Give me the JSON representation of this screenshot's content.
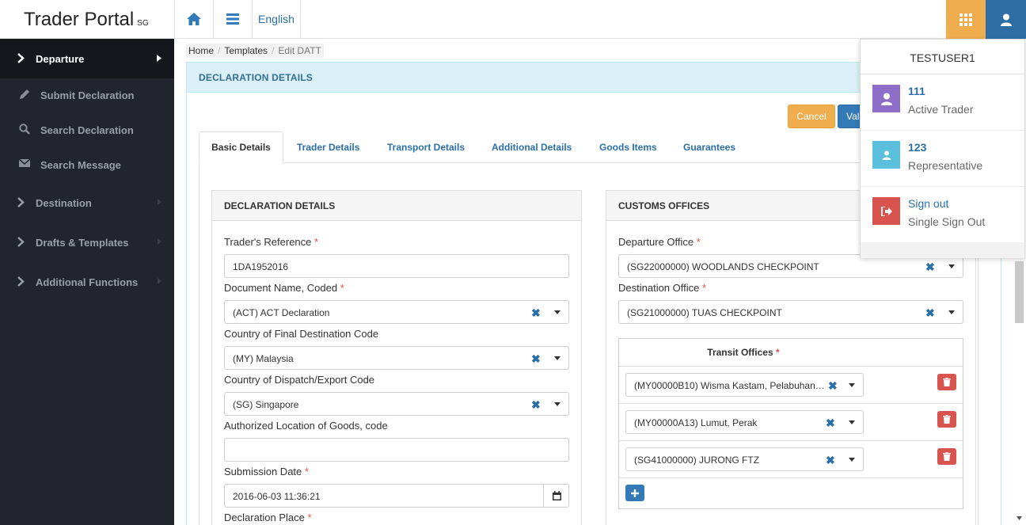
{
  "brand": {
    "title": "Trader Portal",
    "sub": "SG"
  },
  "topbar": {
    "language": "English"
  },
  "sidebar": {
    "departure": "Departure",
    "submit": "Submit Declaration",
    "search": "Search Declaration",
    "search_msg": "Search Message",
    "destination": "Destination",
    "drafts": "Drafts & Templates",
    "additional": "Additional Functions"
  },
  "breadcrumb": {
    "home": "Home",
    "templates": "Templates",
    "current": "Edit DATT"
  },
  "panel": {
    "title": "DECLARATION DETAILS",
    "cancel": "Cancel",
    "validate": "Val"
  },
  "tabs": [
    "Basic Details",
    "Trader Details",
    "Transport Details",
    "Additional Details",
    "Goods Items",
    "Guarantees"
  ],
  "decl": {
    "title": "DECLARATION DETAILS",
    "traders_ref_label": "Trader's Reference",
    "traders_ref": "1DA1952016",
    "doc_name_label": "Document Name, Coded",
    "doc_name": "(ACT) ACT Declaration",
    "country_dest_label": "Country of Final Destination Code",
    "country_dest": "(MY) Malaysia",
    "country_disp_label": "Country of Dispatch/Export Code",
    "country_disp": "(SG) Singapore",
    "auth_loc_label": "Authorized Location of Goods, code",
    "auth_loc": "",
    "sub_date_label": "Submission Date",
    "sub_date": "2016-06-03 11:36:21",
    "decl_place_label": "Declaration Place"
  },
  "customs": {
    "title": "CUSTOMS OFFICES",
    "dep_label": "Departure Office",
    "dep": "(SG22000000) WOODLANDS CHECKPOINT",
    "dest_label": "Destination Office",
    "dest": "(SG21000000) TUAS CHECKPOINT",
    "transit_label": "Transit Offices",
    "transit": [
      "(MY00000B10) Wisma Kastam, Pelabuhan…",
      "(MY00000A13) Lumut, Perak",
      "(SG41000000) JURONG FTZ"
    ]
  },
  "user_menu": {
    "name": "TESTUSER1",
    "items": [
      {
        "t1": "111",
        "t2": "Active Trader",
        "color": "#8e6ec8"
      },
      {
        "t1": "123",
        "t2": "Representative",
        "color": "#5bc0de"
      },
      {
        "t1": "Sign out",
        "t2": "Single Sign Out",
        "color": "#d9534f"
      }
    ]
  }
}
